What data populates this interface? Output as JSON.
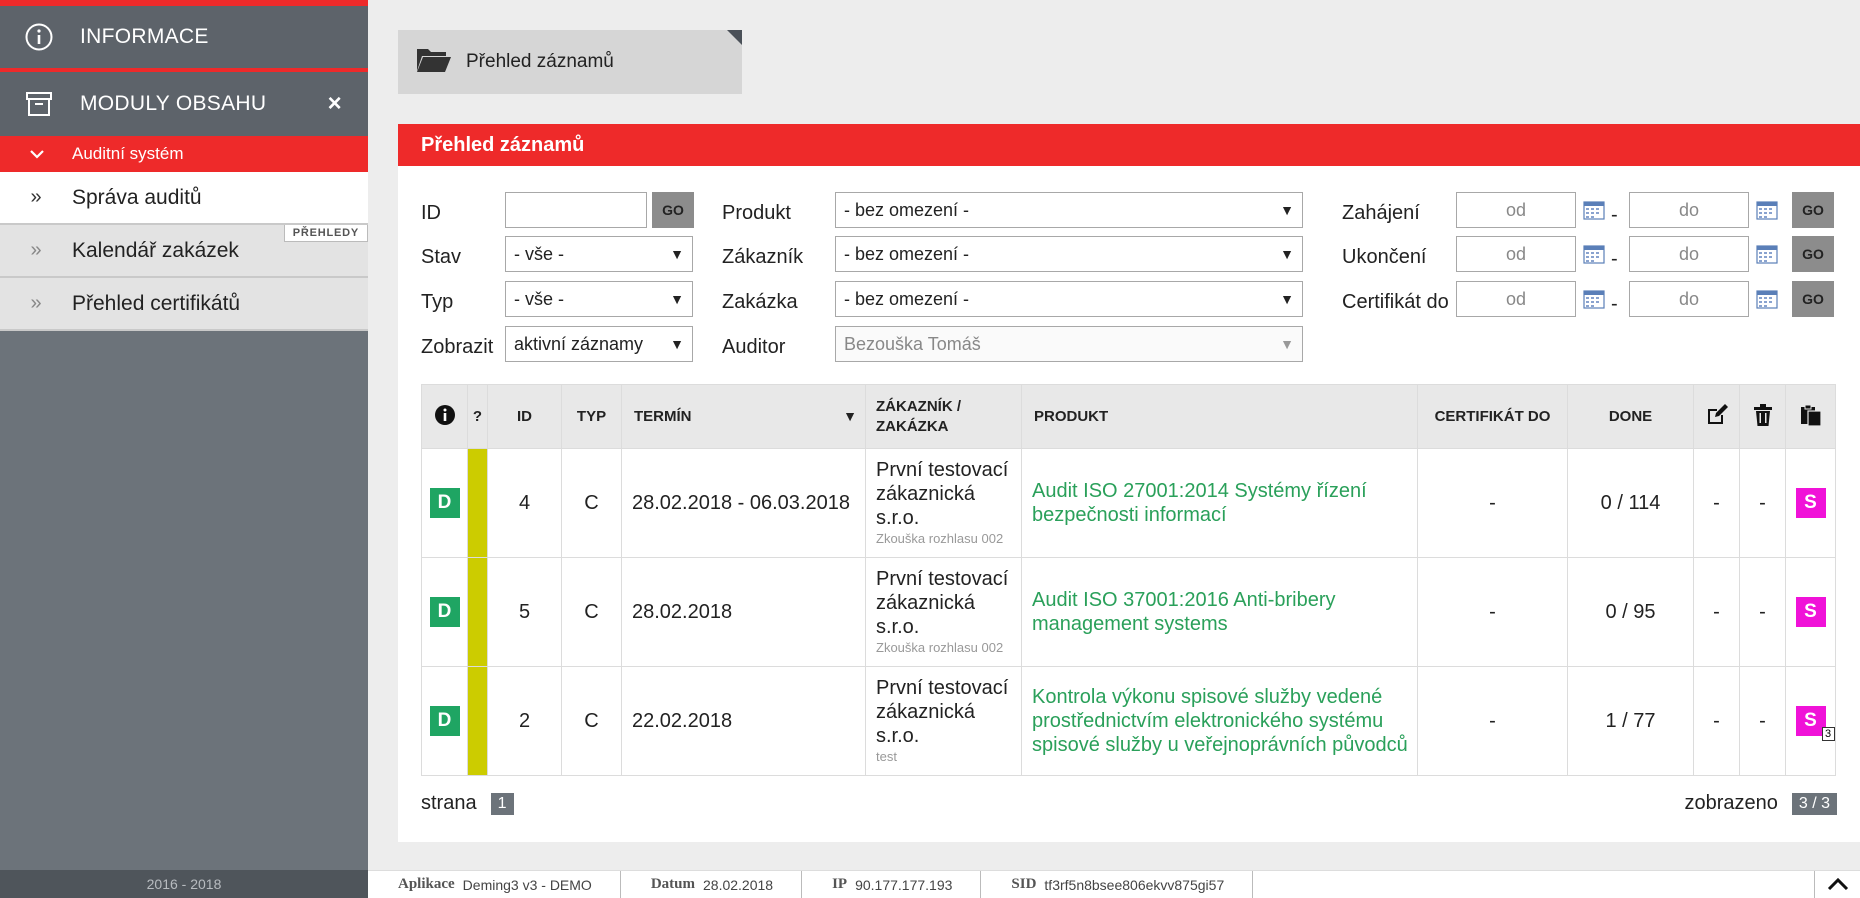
{
  "sidebar": {
    "info_label": "INFORMACE",
    "modules_label": "MODULY OBSAHU",
    "close_glyph": "×",
    "section_label": "Auditní systém",
    "items": [
      {
        "raquo": "»",
        "label": "Správa auditů"
      },
      {
        "raquo": "»",
        "label": "Kalendář zakázek"
      },
      {
        "raquo": "»",
        "label": "Přehled certifikátů"
      }
    ],
    "tag": "PŘEHLEDY",
    "footer": "2016 - 2018"
  },
  "main": {
    "tab_label": "Přehled záznamů",
    "panel_title": "Přehled záznamů"
  },
  "filters": {
    "id_label": "ID",
    "id_value": "",
    "go": "GO",
    "stav_label": "Stav",
    "stav_value": "- vše -",
    "typ_label": "Typ",
    "typ_value": "- vše -",
    "zobrazit_label": "Zobrazit",
    "zobrazit_value": "aktivní záznamy",
    "produkt_label": "Produkt",
    "produkt_value": "- bez omezení -",
    "zakaznik_label": "Zákazník",
    "zakaznik_value": "- bez omezení -",
    "zakazka_label": "Zakázka",
    "zakazka_value": "- bez omezení -",
    "auditor_label": "Auditor",
    "auditor_value": "Bezouška Tomáš",
    "zahajeni_label": "Zahájení",
    "ukonceni_label": "Ukončení",
    "certifikat_label": "Certifikát do",
    "od": "od",
    "do": "do",
    "dash": "-",
    "arrow": "▼"
  },
  "table": {
    "headers": {
      "info": "i",
      "q": "?",
      "id": "ID",
      "typ": "TYP",
      "termin": "TERMÍN",
      "zakaznik_1": "ZÁKAZNÍK /",
      "zakaznik_2": "ZAKÁZKA",
      "produkt": "PRODUKT",
      "certifikat": "CERTIFIKÁT DO",
      "done": "DONE"
    },
    "rows": [
      {
        "badge": "D",
        "id": "4",
        "typ": "C",
        "termin": "28.02.2018 - 06.03.2018",
        "cust_1": "První testovací",
        "cust_2": "zákaznická",
        "cust_3": "s.r.o.",
        "cust_sub": "Zkouška rozhlasu 002",
        "prod_1": "Audit ISO 27001:2014 Systémy řízení",
        "prod_2": "bezpečnosti informací",
        "prod_3": "",
        "cert": "-",
        "done": "0 / 114",
        "edit": "-",
        "del": "-",
        "s": "S",
        "s_count": ""
      },
      {
        "badge": "D",
        "id": "5",
        "typ": "C",
        "termin": "28.02.2018",
        "cust_1": "První testovací",
        "cust_2": "zákaznická",
        "cust_3": "s.r.o.",
        "cust_sub": "Zkouška rozhlasu 002",
        "prod_1": "Audit ISO 37001:2016 Anti-bribery",
        "prod_2": "management systems",
        "prod_3": "",
        "cert": "-",
        "done": "0 / 95",
        "edit": "-",
        "del": "-",
        "s": "S",
        "s_count": ""
      },
      {
        "badge": "D",
        "id": "2",
        "typ": "C",
        "termin": "22.02.2018",
        "cust_1": "První testovací",
        "cust_2": "zákaznická",
        "cust_3": "s.r.o.",
        "cust_sub": "test",
        "prod_1": "Kontrola výkonu spisové služby vedené",
        "prod_2": "prostřednictvím elektronického systému",
        "prod_3": "spisové služby u veřejnoprávních původců",
        "cert": "-",
        "done": "1 / 77",
        "edit": "-",
        "del": "-",
        "s": "S",
        "s_count": "3"
      }
    ]
  },
  "pager": {
    "label": "strana",
    "page": "1",
    "shown_label": "zobrazeno",
    "shown_value": "3 / 3"
  },
  "status": {
    "app_label": "Aplikace",
    "app_value": "Deming3 v3 - DEMO",
    "date_label": "Datum",
    "date_value": "28.02.2018",
    "ip_label": "IP",
    "ip_value": "90.177.177.193",
    "sid_label": "SID",
    "sid_value": "tf3rf5n8bsee806ekvv875gi57"
  },
  "colors": {
    "accent": "#ee2a2a",
    "sidebar": "#6c737a",
    "green_badge": "#1fa563",
    "magenta_badge": "#f012d8",
    "stripe": "#cccc00",
    "link_green": "#2aa05a"
  }
}
